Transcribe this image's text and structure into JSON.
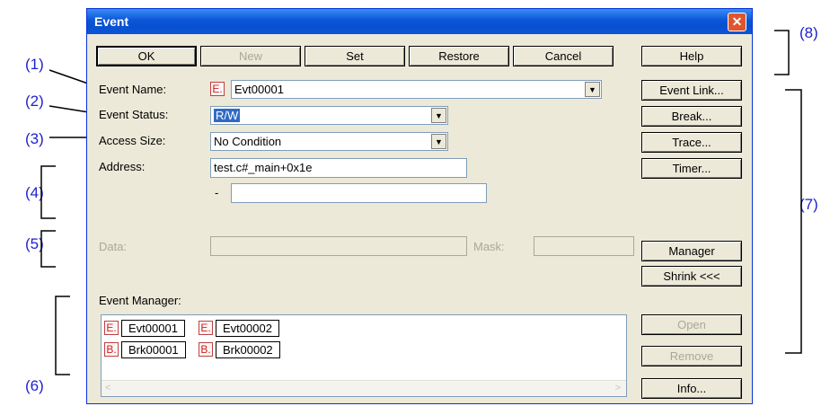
{
  "window": {
    "title": "Event"
  },
  "toolbar": {
    "ok": "OK",
    "new": "New",
    "set": "Set",
    "restore": "Restore",
    "cancel": "Cancel",
    "help": "Help"
  },
  "form": {
    "event_name_label": "Event Name:",
    "event_name_badge": "E.",
    "event_name_value": "Evt00001",
    "event_status_label": "Event Status:",
    "event_status_value": "R/W",
    "access_size_label": "Access Size:",
    "access_size_value": "No Condition",
    "address_label": "Address:",
    "address_value": "test.c#_main+0x1e",
    "range_dash": "-",
    "range_value": "",
    "data_label": "Data:",
    "mask_label": "Mask:"
  },
  "side_buttons": {
    "event_link": "Event Link...",
    "break": "Break...",
    "trace": "Trace...",
    "timer": "Timer...",
    "manager": "Manager",
    "shrink": "Shrink <<<",
    "open": "Open",
    "remove": "Remove",
    "info": "Info..."
  },
  "event_manager": {
    "label": "Event Manager:",
    "items": [
      {
        "badge": "E.",
        "name": "Evt00001"
      },
      {
        "badge": "E.",
        "name": "Evt00002"
      },
      {
        "badge": "B.",
        "name": "Brk00001"
      },
      {
        "badge": "B.",
        "name": "Brk00002"
      }
    ]
  },
  "callouts": {
    "c1": "(1)",
    "c2": "(2)",
    "c3": "(3)",
    "c4": "(4)",
    "c5": "(5)",
    "c6": "(6)",
    "c7": "(7)",
    "c8": "(8)"
  },
  "colors": {
    "callout": "#1f1fcf",
    "title_bar": "#0a56d8",
    "window_bg": "#ece9d8",
    "badge": "#d02020"
  }
}
